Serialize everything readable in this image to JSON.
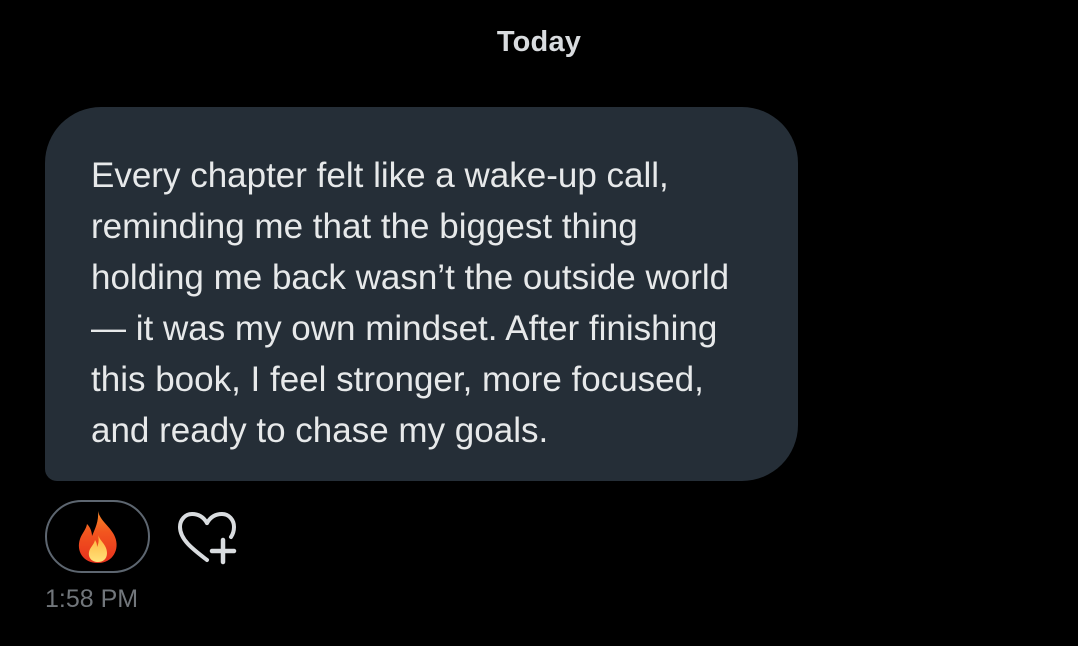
{
  "conversation": {
    "date_divider": "Today"
  },
  "message": {
    "text": "Every chapter felt like a wake-up call, reminding me that the biggest thing holding me back wasn’t the outside world — it was my own mindset. After finishing this book, I feel stronger, more focused, and ready to chase my goals.",
    "timestamp": "1:58 PM",
    "bubble_color": "#252e37",
    "text_color": "#e7e9ea"
  },
  "reactions": {
    "items": [
      {
        "emoji": "🔥",
        "icon": "fire-icon"
      }
    ],
    "add_reaction_icon": "heart-plus-icon"
  }
}
